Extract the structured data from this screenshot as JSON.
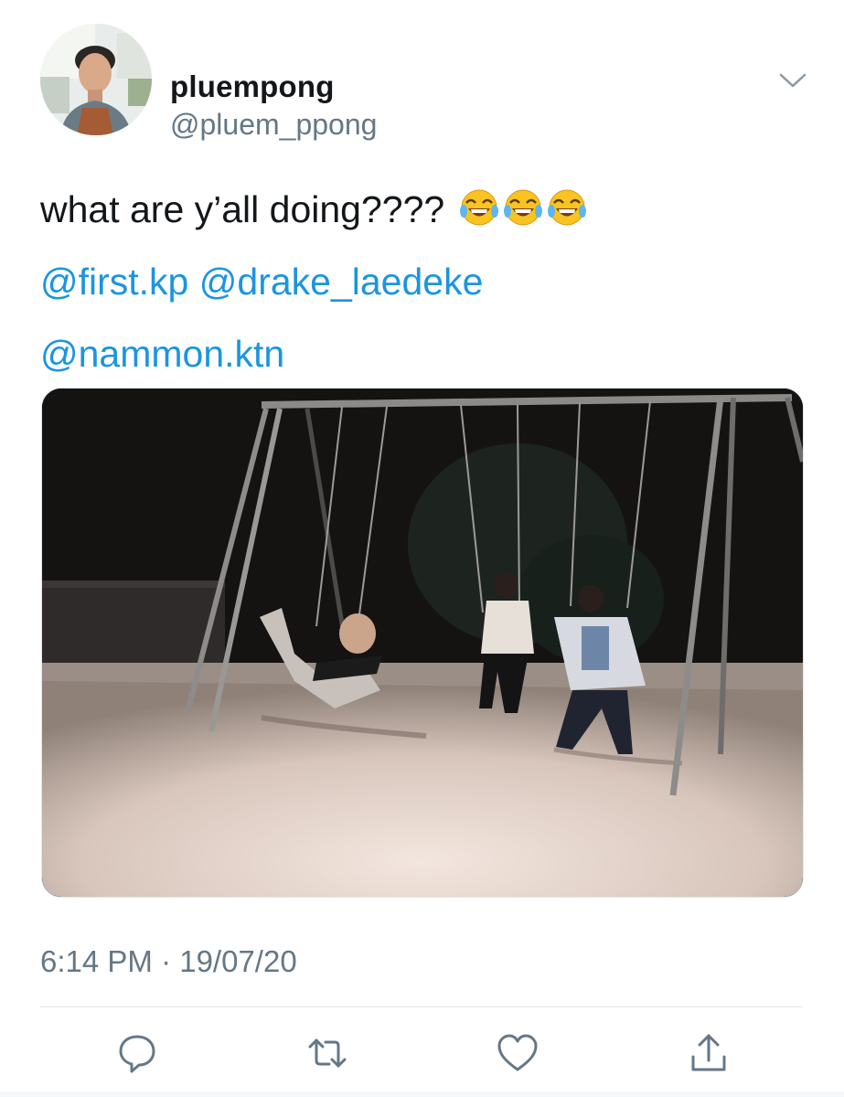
{
  "user": {
    "display_name": "pluempong",
    "handle": "@pluem_ppong"
  },
  "tweet": {
    "text": "what are y’all doing????",
    "emoji": [
      "face-with-tears-of-joy",
      "face-with-tears-of-joy",
      "face-with-tears-of-joy"
    ],
    "mentions_line1": [
      "@first.kp",
      "@drake_laedeke"
    ],
    "mentions_line2": [
      "@nammon.ktn"
    ],
    "timestamp": "6:14 PM · 19/07/20"
  },
  "icons": {
    "menu": "chevron-down-icon",
    "reply": "reply-icon",
    "retweet": "retweet-icon",
    "like": "heart-icon",
    "share": "share-icon"
  },
  "colors": {
    "link": "#1b95e0",
    "secondary_text": "#657786",
    "primary_text": "#14171a"
  }
}
